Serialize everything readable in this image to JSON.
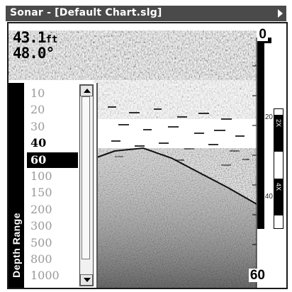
{
  "window": {
    "title": "Sonar - [Default Chart.slg]"
  },
  "readouts": {
    "depth_value": "43.1",
    "depth_unit": "ft",
    "temperature": "48.0°"
  },
  "scale": {
    "top": "0",
    "mid_upper": "20",
    "mid_lower": "40",
    "bottom": "60"
  },
  "zoom": {
    "upper_label": "2X",
    "lower_label": "4X"
  },
  "depth_range": {
    "title": "Depth Range",
    "options": [
      "10",
      "20",
      "30",
      "40",
      "60",
      "100",
      "150",
      "200",
      "300",
      "500",
      "800",
      "1000"
    ],
    "current": "40",
    "selected": "60"
  },
  "icons": {
    "menu": "arrow-right-icon",
    "scroll_up": "arrow-up-icon",
    "scroll_down": "arrow-down-icon"
  },
  "colors": {
    "title_bar": "#4a4a4a",
    "selection": "#000000",
    "inactive_text": "#9a9a9a"
  }
}
